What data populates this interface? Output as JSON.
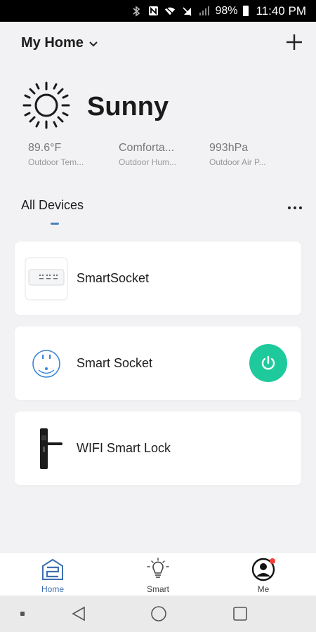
{
  "status_bar": {
    "battery": "98%",
    "time": "11:40 PM",
    "icons": [
      "bluetooth-icon",
      "nfc-icon",
      "wifi-icon",
      "mute-icon",
      "signal-icon",
      "battery-icon"
    ]
  },
  "header": {
    "home_name": "My Home",
    "add_icon": "plus-icon"
  },
  "weather": {
    "condition": "Sunny",
    "icon": "sun-icon",
    "stats": [
      {
        "value": "89.6°F",
        "label": "Outdoor Tem..."
      },
      {
        "value": "Comforta...",
        "label": "Outdoor Hum..."
      },
      {
        "value": "993hPa",
        "label": "Outdoor Air P..."
      }
    ]
  },
  "devices_section": {
    "title": "All Devices",
    "more_icon": "more-horizontal-icon"
  },
  "devices": [
    {
      "name": "SmartSocket",
      "icon": "power-strip-icon"
    },
    {
      "name": "Smart Socket",
      "icon": "socket-icon",
      "power_state": "on",
      "power_color": "#1ec99b"
    },
    {
      "name": "WIFI Smart Lock",
      "icon": "door-lock-icon"
    }
  ],
  "bottom_nav": [
    {
      "label": "Home",
      "icon": "home-icon",
      "active": true
    },
    {
      "label": "Smart",
      "icon": "bulb-icon",
      "active": false
    },
    {
      "label": "Me",
      "icon": "profile-icon",
      "active": false,
      "badge": true
    }
  ],
  "colors": {
    "accent": "#3d6fb0",
    "power_on": "#1ec99b",
    "badge": "#f2403a"
  }
}
